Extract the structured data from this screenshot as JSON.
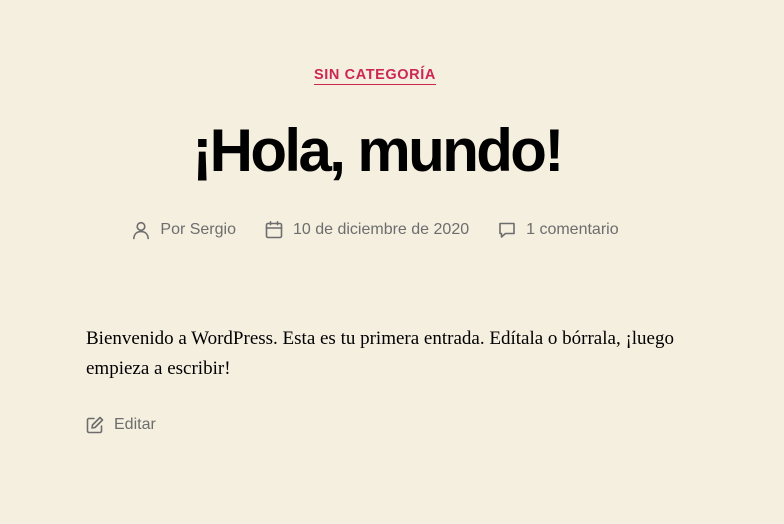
{
  "post": {
    "category": "SIN CATEGORÍA",
    "title": "¡Hola, mundo!",
    "meta": {
      "author": "Por Sergio",
      "date": "10 de diciembre de 2020",
      "comments": "1 comentario",
      "author_icon": "user-icon",
      "date_icon": "calendar-icon",
      "comments_icon": "comment-icon"
    },
    "content": "Bienvenido a WordPress. Esta es tu primera entrada. Edítala o bórrala, ¡luego empieza a escribir!",
    "edit_label": "Editar",
    "edit_icon": "edit-icon"
  },
  "colors": {
    "background": "#f5efe0",
    "accent": "#cd2653",
    "meta_text": "#6d6d6d"
  }
}
